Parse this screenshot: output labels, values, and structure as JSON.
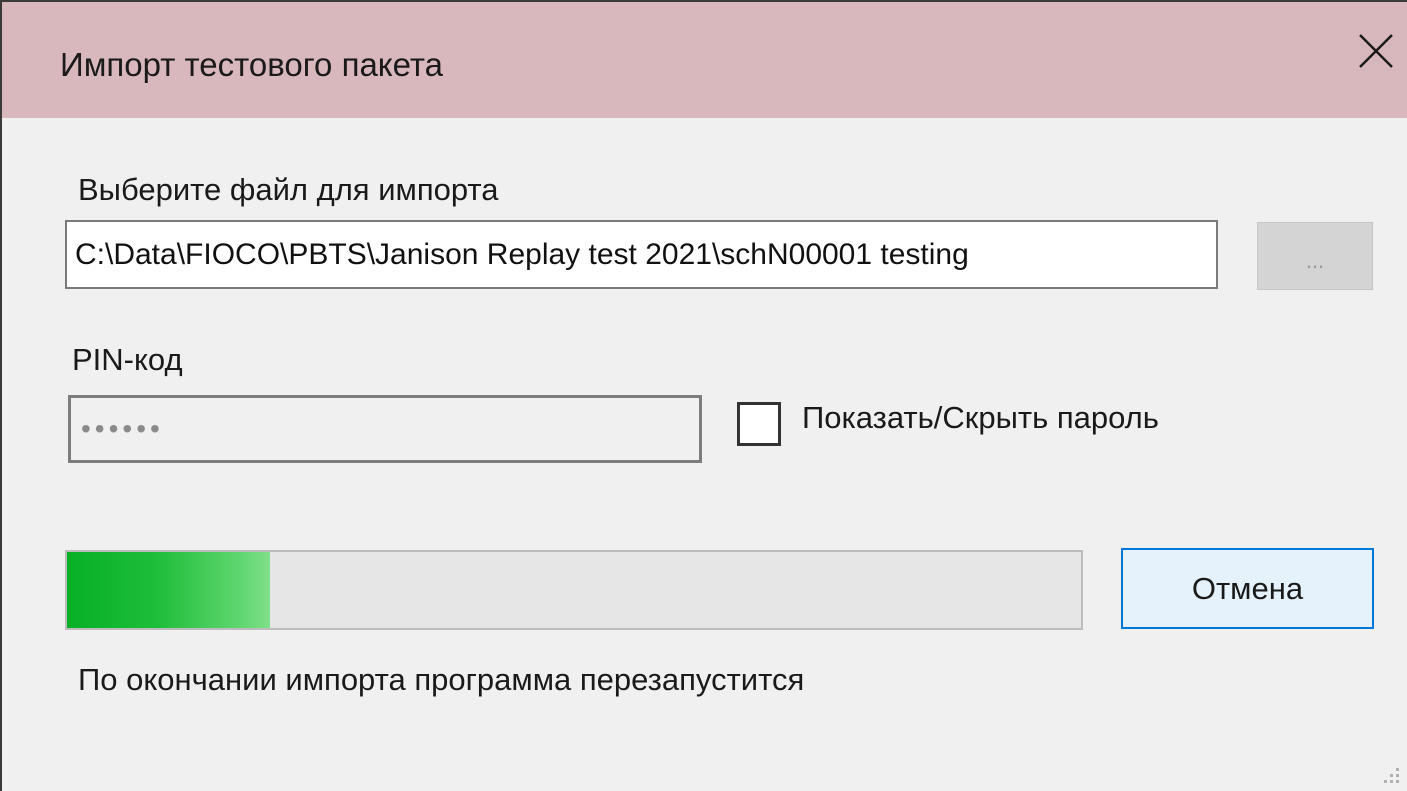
{
  "window": {
    "title": "Импорт тестового пакета",
    "close_icon": "close-x-icon",
    "titlebar_color": "#d9b8bd"
  },
  "file_section": {
    "label": "Выберите файл для импорта",
    "path_value": "C:\\Data\\FIOCO\\PBTS\\Janison Replay test 2021\\schN00001 testing",
    "browse_label": "..."
  },
  "pin_section": {
    "label": "PIN-код",
    "masked_value": "••••••",
    "show_password_label": "Показать/Скрыть пароль",
    "show_password_checked": false
  },
  "progress": {
    "percent": 20,
    "fill_color": "#06b025"
  },
  "actions": {
    "cancel_label": "Отмена"
  },
  "status": {
    "message": "По окончании импорта программа перезапустится"
  },
  "accent_color": "#0078d7"
}
